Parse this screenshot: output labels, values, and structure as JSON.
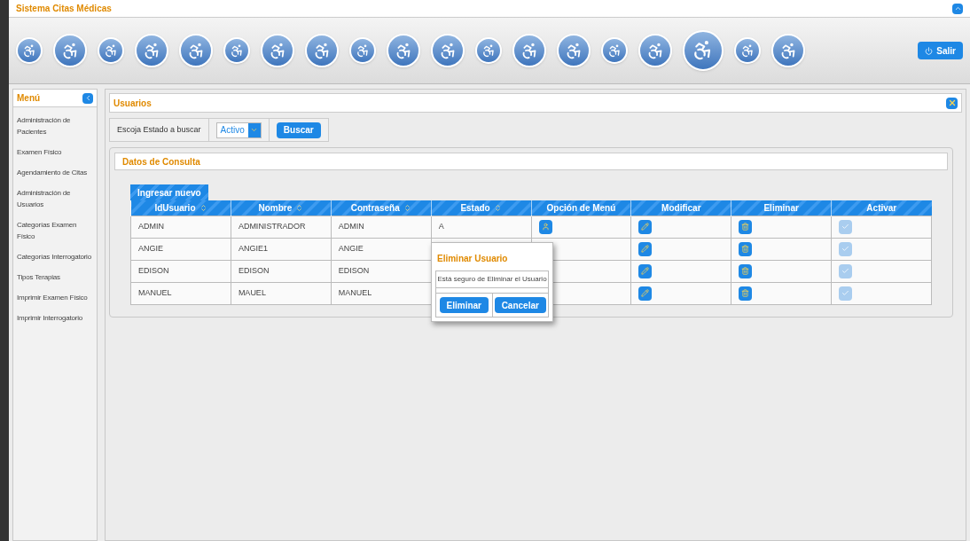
{
  "window": {
    "title": "Sistema Citas Médicas"
  },
  "banner": {
    "exit_button": "Salir"
  },
  "sidebar": {
    "title": "Menú",
    "items": [
      {
        "label": "Administración de Pacientes"
      },
      {
        "label": "Examen Físico"
      },
      {
        "label": "Agendamiento de Citas"
      },
      {
        "label": "Administración de Usuarios"
      },
      {
        "label": "Categorías Examen Físico"
      },
      {
        "label": "Categorías Interrogatorio"
      },
      {
        "label": "Tipos Terapias"
      },
      {
        "label": "Imprimir Examen Físico"
      },
      {
        "label": "Imprimir Interrogatorio"
      }
    ]
  },
  "panel": {
    "title": "Usuarios",
    "filter": {
      "label": "Escoja Estado a buscar",
      "value": "Activo",
      "button": "Buscar"
    },
    "section": {
      "title": "Datos de Consulta",
      "new_button": "Ingresar nuevo",
      "columns": [
        {
          "label": "IdUsuario",
          "sortable": true
        },
        {
          "label": "Nombre",
          "sortable": true
        },
        {
          "label": "Contraseña",
          "sortable": true
        },
        {
          "label": "Estado",
          "sortable": true
        },
        {
          "label": "Opción de Menú",
          "sortable": false
        },
        {
          "label": "Modificar",
          "sortable": false
        },
        {
          "label": "Eliminar",
          "sortable": false
        },
        {
          "label": "Activar",
          "sortable": false
        }
      ],
      "rows": [
        {
          "id": "ADMIN",
          "name": "ADMINISTRADOR",
          "password": "ADMIN",
          "status": "A",
          "activate_disabled": true
        },
        {
          "id": "ANGIE",
          "name": "ANGIE1",
          "password": "ANGIE",
          "activate_disabled": true
        },
        {
          "id": "EDISON",
          "name": "EDISON",
          "password": "EDISON",
          "activate_disabled": true
        },
        {
          "id": "MANUEL",
          "name": "MAUEL",
          "password": "MANUEL",
          "activate_disabled": true
        }
      ]
    }
  },
  "dialog": {
    "title": "Eliminar Usuario",
    "message": "Está seguro de Eliminar el Usuario",
    "buttons": [
      "Eliminar",
      "Cancelar"
    ]
  }
}
